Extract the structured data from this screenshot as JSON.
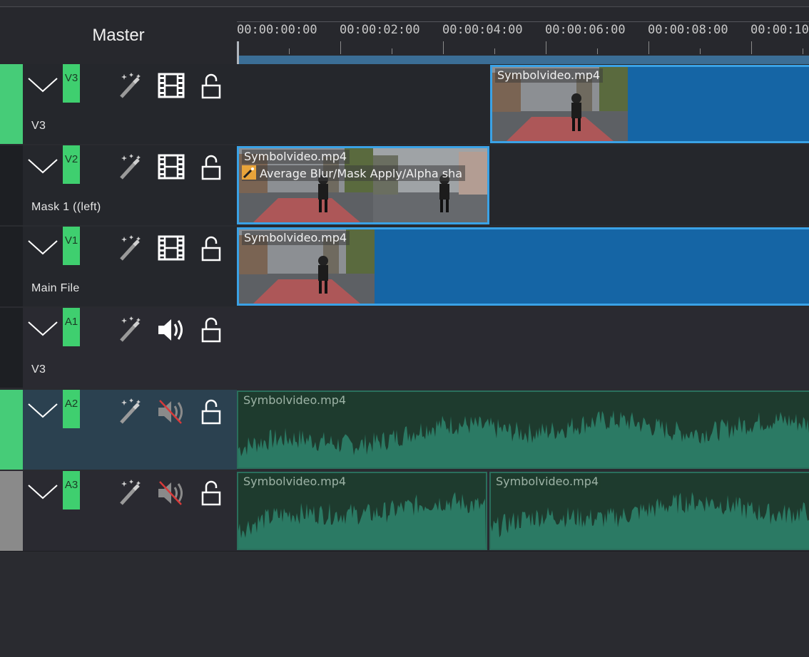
{
  "master": {
    "title": "Master"
  },
  "ruler": {
    "labels": [
      "00:00:00:00",
      "00:00:02:00",
      "00:00:04:00",
      "00:00:06:00",
      "00:00:08:00",
      "00:00:10"
    ]
  },
  "tracks": [
    {
      "tag": "V3",
      "name": "V3",
      "kind": "video",
      "strip_color": "#46cc78"
    },
    {
      "tag": "V2",
      "name": "Mask 1  ((left)",
      "kind": "video",
      "strip_color": "#1d1f23"
    },
    {
      "tag": "V1",
      "name": "Main File",
      "kind": "video",
      "strip_color": "#1d1f23"
    },
    {
      "tag": "A1",
      "name": "V3",
      "kind": "audio",
      "strip_color": "#1d1f23"
    },
    {
      "tag": "A2",
      "name": "",
      "kind": "audio-muted",
      "strip_color": "#46cc78"
    },
    {
      "tag": "A3",
      "name": "",
      "kind": "audio-muted",
      "strip_color": "#8a8a8a"
    }
  ],
  "clips": {
    "v3_clip": "Symbolvideo.mp4",
    "v2_clip": "Symbolvideo.mp4",
    "v2_effect": "Average Blur/Mask Apply/Alpha sha",
    "v1_clip": "Symbolvideo.mp4",
    "a2_clip": "Symbolvideo.mp4",
    "a3_clip_1": "Symbolvideo.mp4",
    "a3_clip_2": "Symbolvideo.mp4"
  },
  "colors": {
    "tag_green": "#3fcf6f",
    "video_clip": "#1565a5",
    "clip_selected_border": "#3aa2e6",
    "audio_clip_bg": "#1e3b2e",
    "waveform": "#2b7a64",
    "fx_badge": "#e9a43a"
  },
  "icons": [
    "chevron-down-icon",
    "effects-wand-icon",
    "film-icon",
    "speaker-icon",
    "speaker-muted-icon",
    "unlocked-padlock-icon"
  ]
}
